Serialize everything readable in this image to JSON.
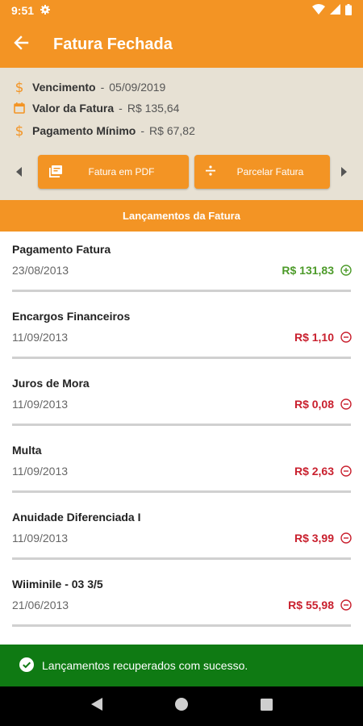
{
  "status_bar": {
    "time": "9:51"
  },
  "app_bar": {
    "title": "Fatura Fechada"
  },
  "summary": {
    "vencimento": {
      "label": "Vencimento",
      "value": "05/09/2019"
    },
    "valor": {
      "label": "Valor da Fatura",
      "value": "R$ 135,64"
    },
    "minimo": {
      "label": "Pagamento Mínimo",
      "value": "R$ 67,82"
    },
    "separator": "-"
  },
  "actions": {
    "pdf_label": "Fatura em PDF",
    "parcelar_label": "Parcelar Fatura"
  },
  "section": {
    "title": "Lançamentos da Fatura"
  },
  "items": [
    {
      "name": "Pagamento Fatura",
      "date": "23/08/2013",
      "amount": "R$ 131,83",
      "type": "credit"
    },
    {
      "name": "Encargos Financeiros",
      "date": "11/09/2013",
      "amount": "R$ 1,10",
      "type": "debit"
    },
    {
      "name": "Juros de Mora",
      "date": "11/09/2013",
      "amount": "R$ 0,08",
      "type": "debit"
    },
    {
      "name": "Multa",
      "date": "11/09/2013",
      "amount": "R$ 2,63",
      "type": "debit"
    },
    {
      "name": "Anuidade Diferenciada I",
      "date": "11/09/2013",
      "amount": "R$ 3,99",
      "type": "debit"
    },
    {
      "name": "Wiiminile - 03 3/5",
      "date": "21/06/2013",
      "amount": "R$ 55,98",
      "type": "debit"
    }
  ],
  "snackbar": {
    "message": "Lançamentos recuperados com sucesso."
  },
  "colors": {
    "primary": "#f39424",
    "summary_bg": "#e7e1d4",
    "credit": "#4d9b2a",
    "debit": "#c9202e",
    "snackbar": "#0f7a13"
  },
  "icons": [
    "settings-icon",
    "wifi-icon",
    "signal-icon",
    "battery-icon",
    "back-arrow-icon",
    "dollar-icon",
    "calendar-icon",
    "pdf-icon",
    "divide-icon",
    "chevron-left-icon",
    "chevron-right-icon",
    "plus-circle-icon",
    "minus-circle-icon",
    "check-circle-icon",
    "nav-back-icon",
    "nav-home-icon",
    "nav-recents-icon"
  ]
}
